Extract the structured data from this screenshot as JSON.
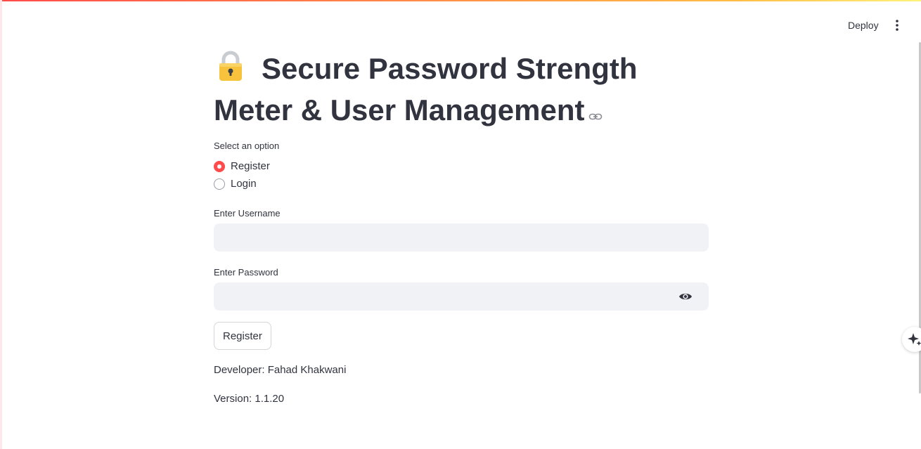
{
  "header": {
    "deploy_label": "Deploy"
  },
  "page": {
    "title": "Secure Password Strength Meter & User Management"
  },
  "radio": {
    "label": "Select an option",
    "options": [
      {
        "label": "Register",
        "selected": true
      },
      {
        "label": "Login",
        "selected": false
      }
    ]
  },
  "form": {
    "username_label": "Enter Username",
    "username_value": "",
    "password_label": "Enter Password",
    "password_value": "",
    "submit_label": "Register"
  },
  "footer": {
    "developer": "Developer: Fahad Khakwani",
    "version": "Version: 1.1.20"
  },
  "colors": {
    "accent": "#ff4b4b",
    "input_bg": "#f0f2f6",
    "text": "#31333f"
  },
  "icons": {
    "title_icon": "lock-icon",
    "anchor_icon": "link-icon",
    "menu_icon": "more-vertical-icon",
    "password_toggle": "eye-icon",
    "assistant": "sparkle-icon"
  }
}
